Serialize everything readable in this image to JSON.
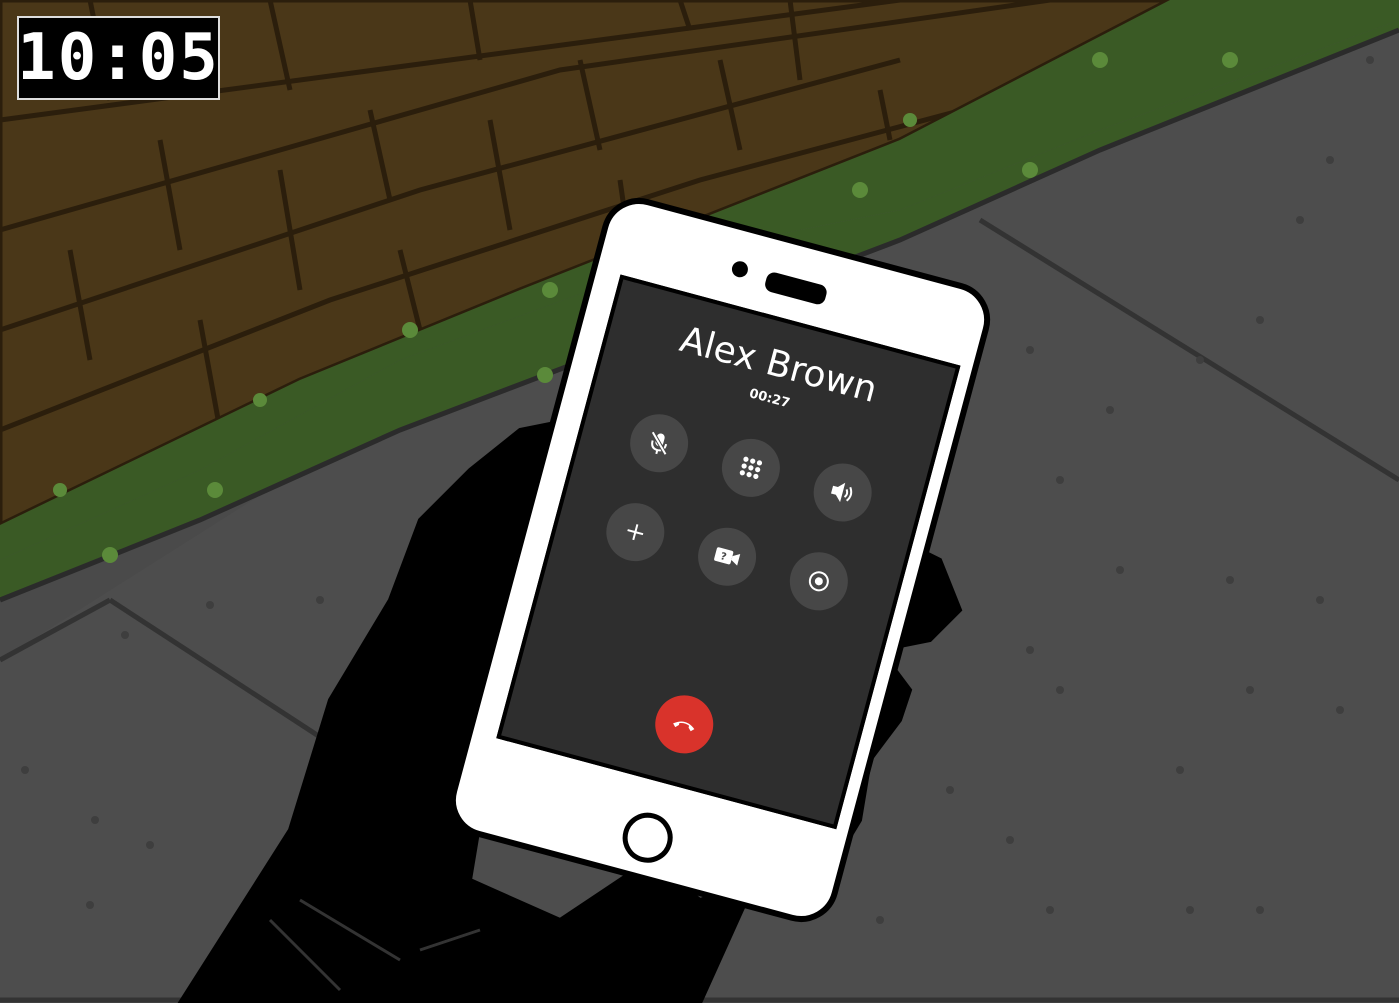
{
  "clock": {
    "time": "10:05"
  },
  "call": {
    "contact_name": "Alex Brown",
    "duration": "00:27"
  },
  "controls": [
    {
      "id": "mute",
      "icon": "microphone-muted-icon"
    },
    {
      "id": "keypad",
      "icon": "keypad-icon"
    },
    {
      "id": "speaker",
      "icon": "speaker-icon"
    },
    {
      "id": "add-call",
      "icon": "plus-icon"
    },
    {
      "id": "video",
      "icon": "video-camera-icon"
    },
    {
      "id": "record",
      "icon": "record-icon"
    },
    {
      "id": "end-call",
      "icon": "phone-hangup-icon"
    }
  ],
  "colors": {
    "end_call": "#d9332b",
    "screen": "#2e2e2e",
    "button": "#474747",
    "wall": "#4a3718",
    "grass": "#3a5a25",
    "pavement": "#4a4a4a"
  }
}
